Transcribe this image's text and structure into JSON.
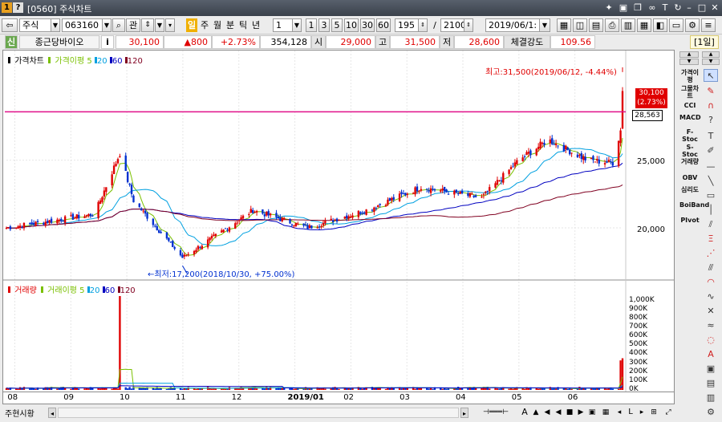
{
  "window": {
    "number_badge": "1",
    "help_badge": "?",
    "title": "[0560] 주식차트",
    "title_icons": [
      "pin-icon",
      "save-icon",
      "copy-icon",
      "link-icon",
      "font-icon",
      "refresh-icon",
      "menu-icon",
      "minimize-icon",
      "maximize-icon",
      "close-icon"
    ]
  },
  "toolbar": {
    "market": "주식",
    "code": "063160",
    "search_btn": "⌕",
    "gwan_btn": "관",
    "period_day": "일",
    "period_week": "주",
    "period_month": "월",
    "period_minute": "분",
    "period_tick": "틱",
    "period_year": "년",
    "interval_value": "1",
    "quick_1": "1",
    "quick_3": "3",
    "quick_5": "5",
    "quick_10": "10",
    "quick_30": "30",
    "quick_60": "60",
    "count_value": "195",
    "slash": "/",
    "total_value": "2100",
    "date_value": "2019/06/1:"
  },
  "quote": {
    "badge": "신",
    "name": "종근당바이오",
    "info": "i",
    "price": "30,100",
    "change": "▲800",
    "change_pct": "+2.73%",
    "volume": "354,128",
    "open_label": "시",
    "open": "29,000",
    "high_label": "고",
    "high": "31,500",
    "low_label": "저",
    "low": "28,600",
    "strength_label": "체결강도",
    "strength": "109.56",
    "period_badge": "[1일]"
  },
  "price_panel": {
    "legend_title": "가격차트",
    "legend_ma_label": "가격이평",
    "ma_periods": [
      "5",
      "20",
      "60",
      "120"
    ],
    "max_annotation": "최고:31,500(2019/06/12, -4.44%)",
    "min_annotation": "←최저:17,200(2018/10/30, +75.00%)",
    "last_price_label": "30,100",
    "last_pct_label": "(2.73%)",
    "hline_label": "28,563",
    "y_ticks": [
      "25,000",
      "20,000"
    ]
  },
  "volume_panel": {
    "legend_title": "거래량",
    "legend_ma_label": "거래이평",
    "ma_periods": [
      "5",
      "20",
      "60",
      "120"
    ],
    "y_ticks": [
      "1,000K",
      "900K",
      "800K",
      "700K",
      "600K",
      "500K",
      "400K",
      "300K",
      "200K",
      "100K",
      "0K"
    ]
  },
  "x_ticks": [
    "08",
    "09",
    "10",
    "11",
    "12",
    "2019/01",
    "02",
    "03",
    "04",
    "05",
    "06"
  ],
  "colors": {
    "up": "#e00000",
    "down": "#0030d0",
    "ma5": "#7ac000",
    "ma20": "#00a0e0",
    "ma60": "#0000c0",
    "ma120": "#800020",
    "hline": "#e0108a"
  },
  "sidebar": {
    "items": [
      "가격이평",
      "그물차트",
      "CCI",
      "MACD",
      "F-Stoc",
      "S-Stoc",
      "거래량",
      "OBV",
      "심리도",
      "BoiBand",
      "PIvot"
    ]
  },
  "bottom": {
    "label": "주현시황"
  },
  "chart_data": {
    "type": "candlestick",
    "title": "가격차트",
    "ylim": [
      16500,
      32500
    ],
    "x_range": [
      "2018-08-01",
      "2019-06-12"
    ],
    "moving_average_periods": [
      5,
      20,
      60,
      120
    ],
    "horizontal_line": 28563,
    "max": {
      "date": "2019-06-12",
      "value": 31500
    },
    "min": {
      "date": "2018-10-30",
      "value": 17200
    },
    "key_points": [
      {
        "date": "2018-08-01",
        "close": 20000
      },
      {
        "date": "2018-09-15",
        "close": 21000
      },
      {
        "date": "2018-09-28",
        "close": 25500
      },
      {
        "date": "2018-10-05",
        "close": 22000
      },
      {
        "date": "2018-10-30",
        "close": 17800
      },
      {
        "date": "2018-11-20",
        "close": 19800
      },
      {
        "date": "2018-12-05",
        "close": 21300
      },
      {
        "date": "2019-01-02",
        "close": 20000
      },
      {
        "date": "2019-02-01",
        "close": 21300
      },
      {
        "date": "2019-03-01",
        "close": 23000
      },
      {
        "date": "2019-04-01",
        "close": 22200
      },
      {
        "date": "2019-04-20",
        "close": 25000
      },
      {
        "date": "2019-05-05",
        "close": 26500
      },
      {
        "date": "2019-05-25",
        "close": 25000
      },
      {
        "date": "2019-06-07",
        "close": 24800
      },
      {
        "date": "2019-06-11",
        "close": 27200
      },
      {
        "date": "2019-06-12",
        "close": 30100
      }
    ],
    "volume_ylim": [
      0,
      1050
    ],
    "volume_unit": "K",
    "volume_spikes": [
      {
        "date": "2018-09-28",
        "value": 1050
      },
      {
        "date": "2018-12-02",
        "value": 230
      },
      {
        "date": "2019-06-11",
        "value": 330
      },
      {
        "date": "2019-06-12",
        "value": 354
      }
    ]
  }
}
